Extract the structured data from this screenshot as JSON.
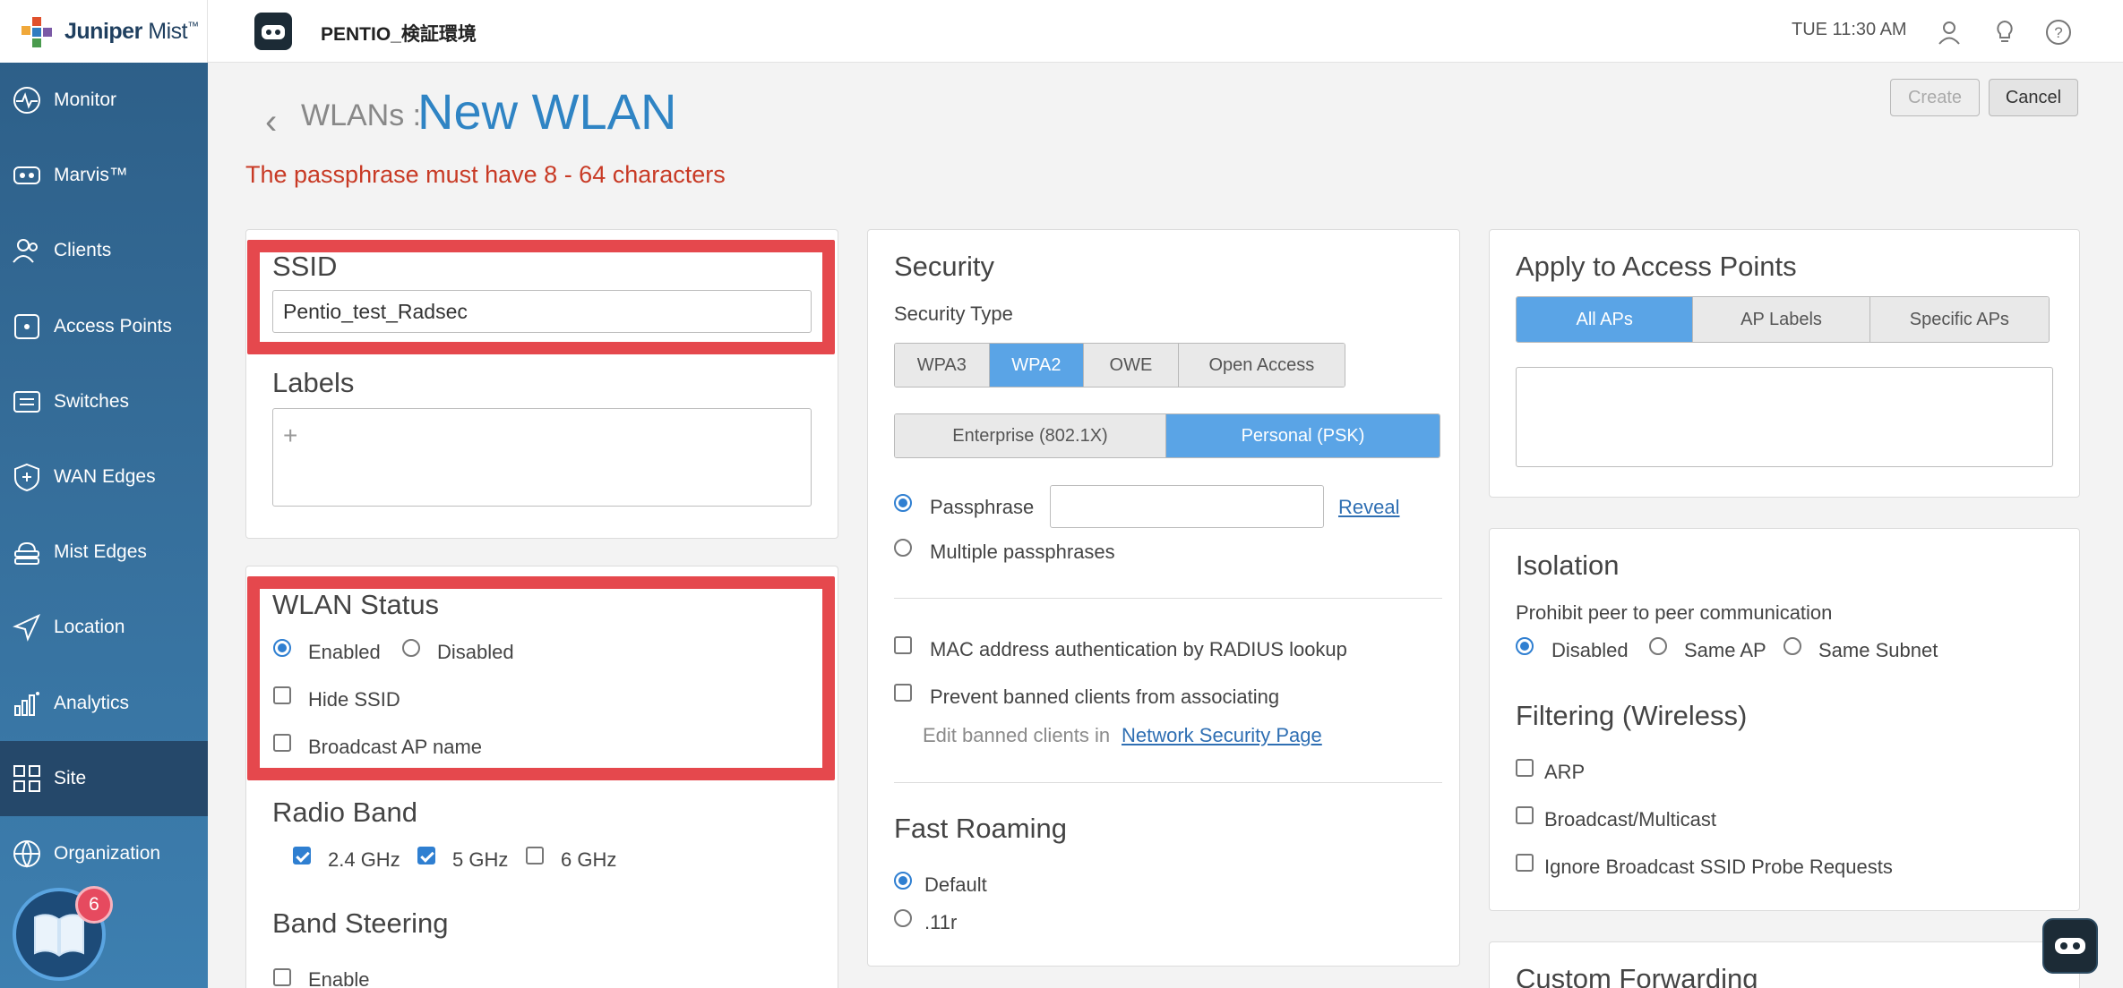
{
  "brand": {
    "name_bold": "Juniper",
    "name_rest": " Mist",
    "trademark": "™"
  },
  "nav": [
    {
      "label": "Monitor",
      "icon": "monitor-icon"
    },
    {
      "label": "Marvis™",
      "icon": "marvis-icon"
    },
    {
      "label": "Clients",
      "icon": "clients-icon"
    },
    {
      "label": "Access Points",
      "icon": "access-point-icon"
    },
    {
      "label": "Switches",
      "icon": "switch-icon"
    },
    {
      "label": "WAN Edges",
      "icon": "wan-edge-icon"
    },
    {
      "label": "Mist Edges",
      "icon": "mist-edge-icon"
    },
    {
      "label": "Location",
      "icon": "location-icon"
    },
    {
      "label": "Analytics",
      "icon": "analytics-icon"
    },
    {
      "label": "Site",
      "icon": "site-icon",
      "active": true
    },
    {
      "label": "Organization",
      "icon": "organization-icon"
    }
  ],
  "notification_count": "6",
  "topbar": {
    "site_name": "PENTIO_検証環境",
    "time": "TUE 11:30 AM"
  },
  "header": {
    "breadcrumb": "WLANs :",
    "title": "New WLAN",
    "error": "The passphrase must have 8 - 64 characters",
    "create_label": "Create",
    "cancel_label": "Cancel"
  },
  "ssid": {
    "heading": "SSID",
    "value": "Pentio_test_Radsec"
  },
  "labels": {
    "heading": "Labels",
    "add": "+"
  },
  "wlan_status": {
    "heading": "WLAN Status",
    "enabled": "Enabled",
    "disabled": "Disabled",
    "selected": "Enabled",
    "hide_ssid": "Hide SSID",
    "broadcast_ap_name": "Broadcast AP name"
  },
  "radio_band": {
    "heading": "Radio Band",
    "b24": "2.4 GHz",
    "b5": "5 GHz",
    "b6": "6 GHz",
    "checked": [
      "2.4 GHz",
      "5 GHz"
    ]
  },
  "band_steering": {
    "heading": "Band Steering",
    "enable": "Enable"
  },
  "security": {
    "heading": "Security",
    "type_label": "Security Type",
    "types": [
      "WPA3",
      "WPA2",
      "OWE",
      "Open Access"
    ],
    "type_selected": "WPA2",
    "modes": [
      "Enterprise (802.1X)",
      "Personal (PSK)"
    ],
    "mode_selected": "Personal (PSK)",
    "passphrase": "Passphrase",
    "passphrase_value": "",
    "reveal": "Reveal",
    "multiple": "Multiple passphrases",
    "mac_auth": "MAC address authentication by RADIUS lookup",
    "prevent_banned": "Prevent banned clients from associating",
    "edit_banned": "Edit banned clients in",
    "net_sec_link": "Network Security Page"
  },
  "fast_roaming": {
    "heading": "Fast Roaming",
    "default": "Default",
    "r11": ".11r",
    "selected": "Default"
  },
  "apply": {
    "heading": "Apply to Access Points",
    "tabs": [
      "All APs",
      "AP Labels",
      "Specific APs"
    ],
    "selected": "All APs"
  },
  "isolation": {
    "heading": "Isolation",
    "subtitle": "Prohibit peer to peer communication",
    "options": [
      "Disabled",
      "Same AP",
      "Same Subnet"
    ],
    "selected": "Disabled"
  },
  "filtering": {
    "heading": "Filtering (Wireless)",
    "arp": "ARP",
    "bcast": "Broadcast/Multicast",
    "probe": "Ignore Broadcast SSID Probe Requests"
  },
  "custom_forwarding": {
    "heading": "Custom Forwarding"
  },
  "colors": {
    "accent": "#2f84c4",
    "error": "#c83a25",
    "highlight": "#e5484d",
    "sidebar": "#2c5d86"
  }
}
